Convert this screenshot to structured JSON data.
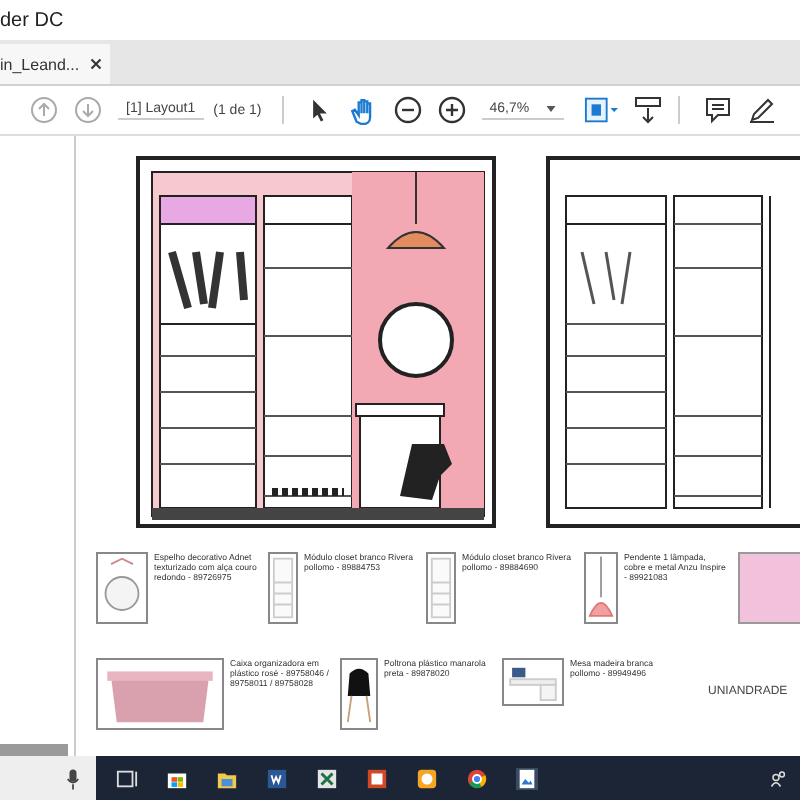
{
  "window": {
    "title": "der DC"
  },
  "tabs": [
    {
      "label": "in_Leand...",
      "selected": true
    }
  ],
  "toolbar": {
    "page_label": "[1] Layout1",
    "page_count": "(1 de 1)",
    "zoom": "46,7%"
  },
  "product_rows": [
    [
      {
        "kind": "mirror",
        "caption": "Espelho decorativo Adnet texturizado com alça couro redondo - 89726975"
      },
      {
        "kind": "module",
        "caption": "Módulo closet branco Rivera pollomo - 89884753"
      },
      {
        "kind": "module",
        "caption": "Módulo closet branco Rivera pollomo - 89884690"
      },
      {
        "kind": "pendant",
        "caption": "Pendente 1 lâmpada, cobre e metal Anzu Inspire - 89921083"
      },
      {
        "kind": "photo"
      }
    ],
    [
      {
        "kind": "box",
        "caption": "Caixa organizadora em plástico rosé - 89758046 / 89758011 / 89758028"
      },
      {
        "kind": "chair",
        "caption": "Poltrona plástico manarola preta - 89878020"
      },
      {
        "kind": "desk",
        "caption": "Mesa madeira branca pollomo - 89949496"
      }
    ]
  ],
  "brand": "UNIANDRADE"
}
